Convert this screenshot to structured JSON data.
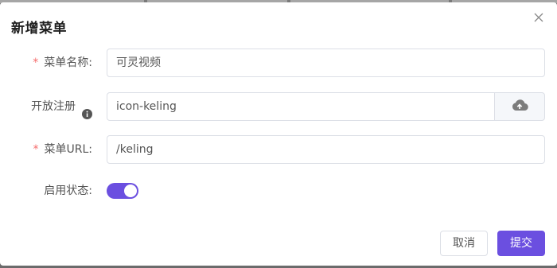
{
  "dialog": {
    "title": "新增菜单",
    "close_icon": "close-icon"
  },
  "form": {
    "menu_name": {
      "label": "菜单名称:",
      "required": true,
      "value": "可灵视频"
    },
    "open_register": {
      "label": "开放注册",
      "info_icon": "info-icon",
      "value": "icon-keling",
      "upload_icon": "cloud-upload-icon"
    },
    "menu_url": {
      "label": "菜单URL:",
      "required": true,
      "value": "/keling"
    },
    "enabled": {
      "label": "启用状态:",
      "on": true
    }
  },
  "footer": {
    "cancel_label": "取消",
    "submit_label": "提交"
  },
  "colors": {
    "accent": "#6b4fe0",
    "required": "#f56c6c"
  }
}
